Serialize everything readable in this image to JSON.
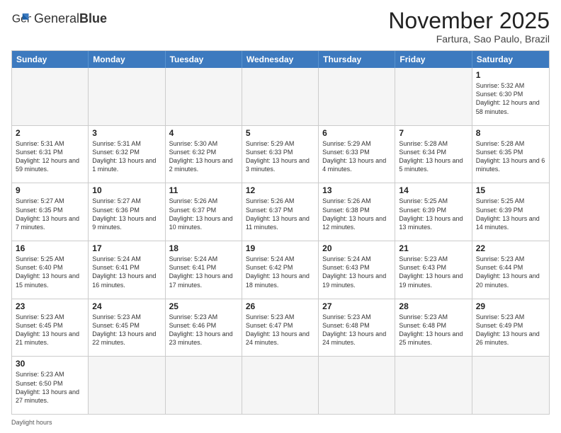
{
  "logo": {
    "text_normal": "General",
    "text_bold": "Blue"
  },
  "title": "November 2025",
  "location": "Fartura, Sao Paulo, Brazil",
  "days_of_week": [
    "Sunday",
    "Monday",
    "Tuesday",
    "Wednesday",
    "Thursday",
    "Friday",
    "Saturday"
  ],
  "footer_note": "Daylight hours",
  "weeks": [
    [
      {
        "day": "",
        "empty": true
      },
      {
        "day": "",
        "empty": true
      },
      {
        "day": "",
        "empty": true
      },
      {
        "day": "",
        "empty": true
      },
      {
        "day": "",
        "empty": true
      },
      {
        "day": "",
        "empty": true
      },
      {
        "day": "1",
        "sunrise": "5:32 AM",
        "sunset": "6:30 PM",
        "daylight": "12 hours and 58 minutes."
      }
    ],
    [
      {
        "day": "2",
        "sunrise": "5:31 AM",
        "sunset": "6:31 PM",
        "daylight": "12 hours and 59 minutes."
      },
      {
        "day": "3",
        "sunrise": "5:31 AM",
        "sunset": "6:32 PM",
        "daylight": "13 hours and 1 minute."
      },
      {
        "day": "4",
        "sunrise": "5:30 AM",
        "sunset": "6:32 PM",
        "daylight": "13 hours and 2 minutes."
      },
      {
        "day": "5",
        "sunrise": "5:29 AM",
        "sunset": "6:33 PM",
        "daylight": "13 hours and 3 minutes."
      },
      {
        "day": "6",
        "sunrise": "5:29 AM",
        "sunset": "6:33 PM",
        "daylight": "13 hours and 4 minutes."
      },
      {
        "day": "7",
        "sunrise": "5:28 AM",
        "sunset": "6:34 PM",
        "daylight": "13 hours and 5 minutes."
      },
      {
        "day": "8",
        "sunrise": "5:28 AM",
        "sunset": "6:35 PM",
        "daylight": "13 hours and 6 minutes."
      }
    ],
    [
      {
        "day": "9",
        "sunrise": "5:27 AM",
        "sunset": "6:35 PM",
        "daylight": "13 hours and 7 minutes."
      },
      {
        "day": "10",
        "sunrise": "5:27 AM",
        "sunset": "6:36 PM",
        "daylight": "13 hours and 9 minutes."
      },
      {
        "day": "11",
        "sunrise": "5:26 AM",
        "sunset": "6:37 PM",
        "daylight": "13 hours and 10 minutes."
      },
      {
        "day": "12",
        "sunrise": "5:26 AM",
        "sunset": "6:37 PM",
        "daylight": "13 hours and 11 minutes."
      },
      {
        "day": "13",
        "sunrise": "5:26 AM",
        "sunset": "6:38 PM",
        "daylight": "13 hours and 12 minutes."
      },
      {
        "day": "14",
        "sunrise": "5:25 AM",
        "sunset": "6:39 PM",
        "daylight": "13 hours and 13 minutes."
      },
      {
        "day": "15",
        "sunrise": "5:25 AM",
        "sunset": "6:39 PM",
        "daylight": "13 hours and 14 minutes."
      }
    ],
    [
      {
        "day": "16",
        "sunrise": "5:25 AM",
        "sunset": "6:40 PM",
        "daylight": "13 hours and 15 minutes."
      },
      {
        "day": "17",
        "sunrise": "5:24 AM",
        "sunset": "6:41 PM",
        "daylight": "13 hours and 16 minutes."
      },
      {
        "day": "18",
        "sunrise": "5:24 AM",
        "sunset": "6:41 PM",
        "daylight": "13 hours and 17 minutes."
      },
      {
        "day": "19",
        "sunrise": "5:24 AM",
        "sunset": "6:42 PM",
        "daylight": "13 hours and 18 minutes."
      },
      {
        "day": "20",
        "sunrise": "5:24 AM",
        "sunset": "6:43 PM",
        "daylight": "13 hours and 19 minutes."
      },
      {
        "day": "21",
        "sunrise": "5:23 AM",
        "sunset": "6:43 PM",
        "daylight": "13 hours and 19 minutes."
      },
      {
        "day": "22",
        "sunrise": "5:23 AM",
        "sunset": "6:44 PM",
        "daylight": "13 hours and 20 minutes."
      }
    ],
    [
      {
        "day": "23",
        "sunrise": "5:23 AM",
        "sunset": "6:45 PM",
        "daylight": "13 hours and 21 minutes."
      },
      {
        "day": "24",
        "sunrise": "5:23 AM",
        "sunset": "6:45 PM",
        "daylight": "13 hours and 22 minutes."
      },
      {
        "day": "25",
        "sunrise": "5:23 AM",
        "sunset": "6:46 PM",
        "daylight": "13 hours and 23 minutes."
      },
      {
        "day": "26",
        "sunrise": "5:23 AM",
        "sunset": "6:47 PM",
        "daylight": "13 hours and 24 minutes."
      },
      {
        "day": "27",
        "sunrise": "5:23 AM",
        "sunset": "6:48 PM",
        "daylight": "13 hours and 24 minutes."
      },
      {
        "day": "28",
        "sunrise": "5:23 AM",
        "sunset": "6:48 PM",
        "daylight": "13 hours and 25 minutes."
      },
      {
        "day": "29",
        "sunrise": "5:23 AM",
        "sunset": "6:49 PM",
        "daylight": "13 hours and 26 minutes."
      }
    ],
    [
      {
        "day": "30",
        "sunrise": "5:23 AM",
        "sunset": "6:50 PM",
        "daylight": "13 hours and 27 minutes."
      },
      {
        "day": "",
        "empty": true
      },
      {
        "day": "",
        "empty": true
      },
      {
        "day": "",
        "empty": true
      },
      {
        "day": "",
        "empty": true
      },
      {
        "day": "",
        "empty": true
      },
      {
        "day": "",
        "empty": true
      }
    ]
  ]
}
